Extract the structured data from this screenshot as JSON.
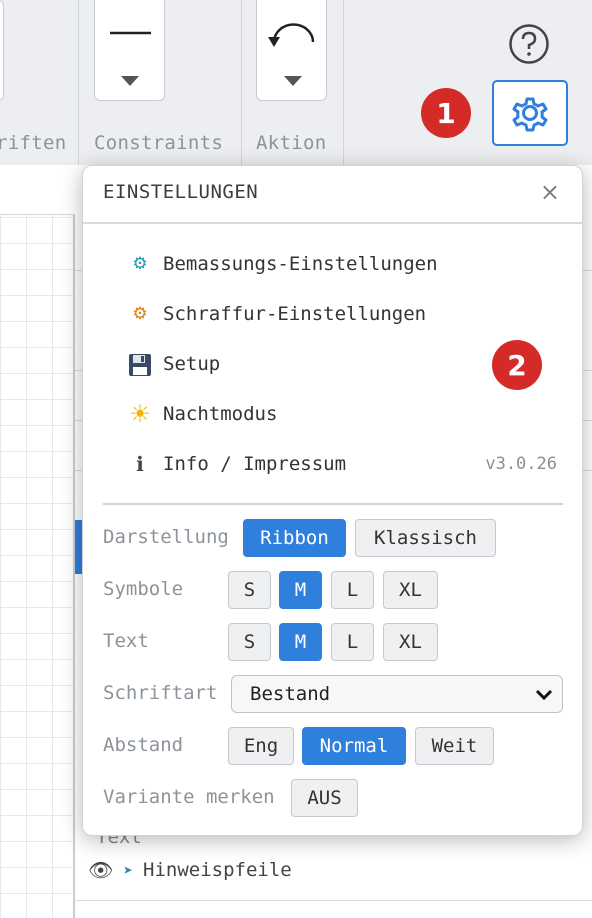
{
  "ribbon": {
    "groups": [
      {
        "label": "riften"
      },
      {
        "label": "Constraints"
      },
      {
        "label": "Aktion"
      }
    ],
    "badge1": "1"
  },
  "popup": {
    "title": "EINSTELLUNGEN",
    "close": "×",
    "menu": [
      {
        "icon": "dimension-gear-icon",
        "label": "Bemassungs-Einstellungen"
      },
      {
        "icon": "hatch-gear-icon",
        "label": "Schraffur-Einstellungen"
      },
      {
        "icon": "floppy-disk-icon",
        "label": "Setup"
      },
      {
        "icon": "sun-icon",
        "label": "Nachtmodus"
      },
      {
        "icon": "info-icon",
        "label": "Info / Impressum",
        "version": "v3.0.26"
      }
    ],
    "badge2": "2",
    "settings": {
      "darstellung": {
        "label": "Darstellung",
        "options": [
          "Ribbon",
          "Klassisch"
        ],
        "active": "Ribbon"
      },
      "symbole": {
        "label": "Symbole",
        "options": [
          "S",
          "M",
          "L",
          "XL"
        ],
        "active": "M"
      },
      "text": {
        "label": "Text",
        "options": [
          "S",
          "M",
          "L",
          "XL"
        ],
        "active": "M"
      },
      "schriftart": {
        "label": "Schriftart",
        "value": "Bestand"
      },
      "abstand": {
        "label": "Abstand",
        "options": [
          "Eng",
          "Normal",
          "Weit"
        ],
        "active": "Normal"
      },
      "variante": {
        "label": "Variante merken",
        "value": "AUS"
      }
    }
  },
  "layers": {
    "partial_label": "Text",
    "row_label": "Hinweispfeile"
  },
  "colors": {
    "accent": "#2f7fdd",
    "badge": "#d42a28"
  }
}
